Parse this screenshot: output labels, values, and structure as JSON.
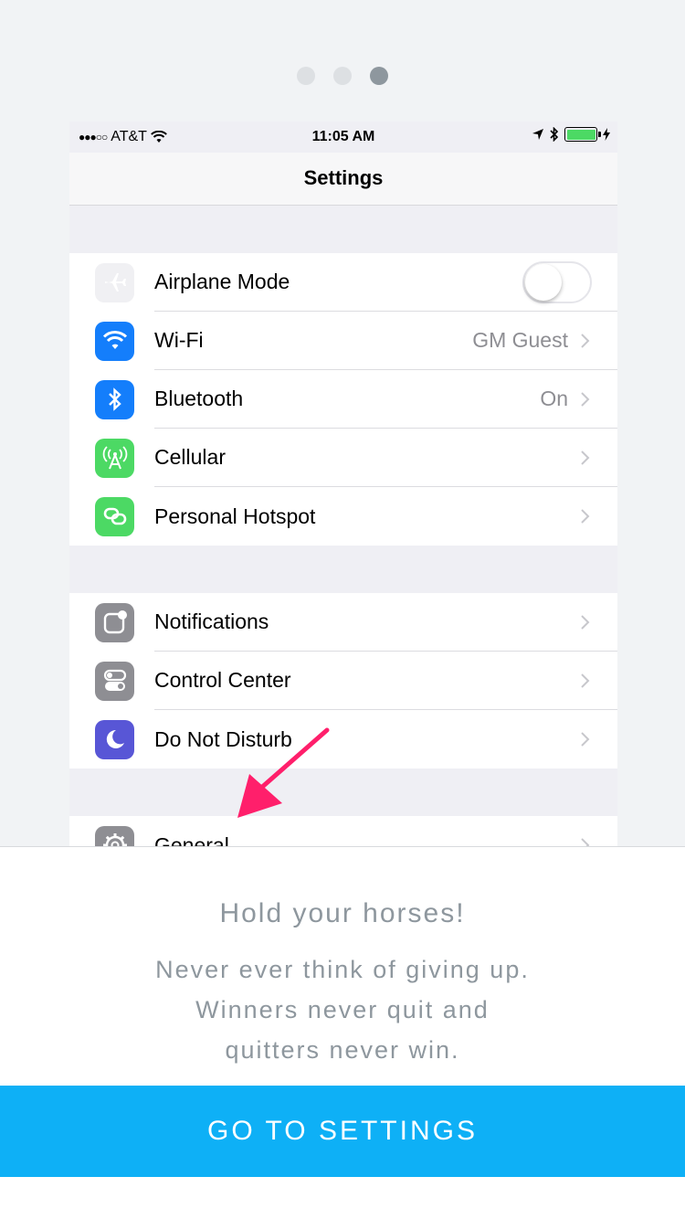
{
  "pager": {
    "count": 3,
    "active_index": 2
  },
  "statusbar": {
    "signal": "●●●○○",
    "carrier": "AT&T",
    "time": "11:05 AM",
    "battery_color": "#4cd964"
  },
  "navbar": {
    "title": "Settings"
  },
  "settings": {
    "group1": [
      {
        "label": "Airplane Mode",
        "icon": "airplane-icon",
        "icon_bg": "#f0f0f3",
        "toggle": false
      },
      {
        "label": "Wi-Fi",
        "value": "GM Guest",
        "icon": "wifi-icon",
        "icon_bg": "#147efb"
      },
      {
        "label": "Bluetooth",
        "value": "On",
        "icon": "bluetooth-icon",
        "icon_bg": "#147efb"
      },
      {
        "label": "Cellular",
        "icon": "cellular-icon",
        "icon_bg": "#4cd964"
      },
      {
        "label": "Personal Hotspot",
        "icon": "hotspot-icon",
        "icon_bg": "#4cd964"
      }
    ],
    "group2": [
      {
        "label": "Notifications",
        "icon": "notifications-icon",
        "icon_bg": "#8e8e93"
      },
      {
        "label": "Control Center",
        "icon": "control-center-icon",
        "icon_bg": "#8e8e93"
      },
      {
        "label": "Do Not Disturb",
        "icon": "moon-icon",
        "icon_bg": "#5856d6"
      }
    ],
    "group3": [
      {
        "label": "General",
        "icon": "gear-icon",
        "icon_bg": "#8e8e93"
      }
    ]
  },
  "sheet": {
    "title": "Hold your horses!",
    "body_line1": "Never ever think of giving up.",
    "body_line2": "Winners never quit and quitters never win."
  },
  "cta": {
    "label": "GO TO SETTINGS",
    "color": "#0eb0f6"
  },
  "accent": {
    "arrow_color": "#ff1f6b"
  }
}
